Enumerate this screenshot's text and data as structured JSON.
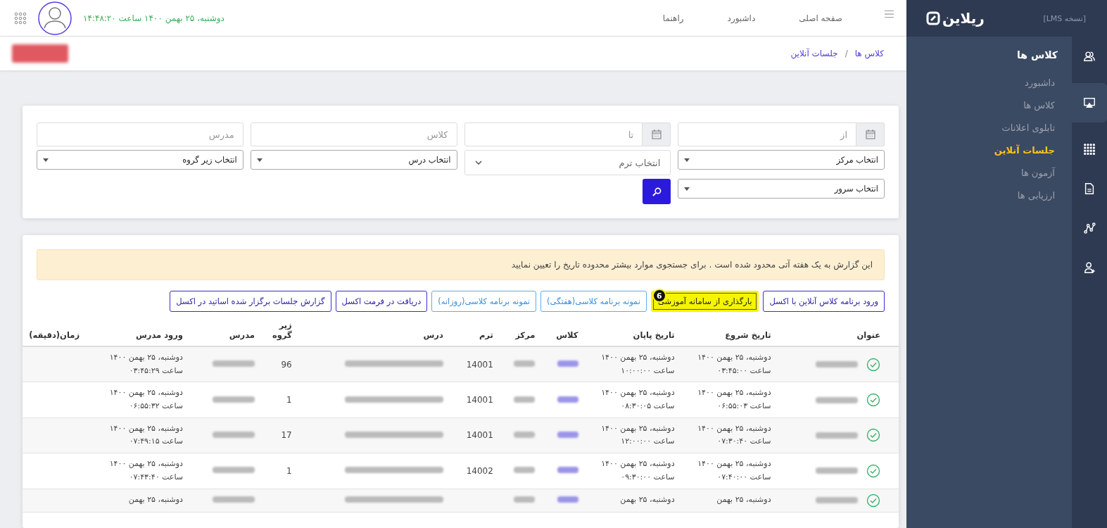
{
  "sidebar": {
    "logo": "ریلاین",
    "version": "[نسخه LMS]",
    "section_title": "کلاس ها",
    "rail": [
      {
        "kind": "users",
        "selected": false
      },
      {
        "kind": "screen",
        "selected": true
      },
      {
        "kind": "grid",
        "selected": false
      },
      {
        "kind": "document",
        "selected": false
      },
      {
        "kind": "graph",
        "selected": false
      },
      {
        "kind": "add-user",
        "selected": false
      }
    ],
    "items": [
      {
        "label": "داشبورد",
        "selected": false
      },
      {
        "label": "کلاس ها",
        "selected": false
      },
      {
        "label": "تابلوی اعلانات",
        "selected": false
      },
      {
        "label": "جلسات آنلاین",
        "selected": true
      },
      {
        "label": "آزمون ها",
        "selected": false
      },
      {
        "label": "ارزیابی ها",
        "selected": false
      }
    ]
  },
  "topbar": {
    "nav": [
      "صفحه اصلی",
      "داشبورد",
      "راهنما"
    ],
    "datetime": "دوشنبه، ۲۵ بهمن ۱۴۰۰ ساعت ۱۴:۴۸:۲۰"
  },
  "breadcrumb": [
    "کلاس ها",
    "جلسات آنلاین"
  ],
  "breadcrumb_separator": "/",
  "filters": {
    "from": {
      "placeholder": "از"
    },
    "to": {
      "placeholder": "تا"
    },
    "class": {
      "placeholder": "کلاس"
    },
    "teacher": {
      "placeholder": "مدرس"
    },
    "center": "انتخاب مرکز",
    "term": "انتخاب ترم",
    "lesson": "انتخاب درس",
    "subgroup": "انتخاب زیر گروه",
    "server": "انتخاب سرور"
  },
  "alert": "این گزارش به یک هفته آتی محدود شده است . برای جستجوی موارد بیشتر محدوده تاریخ را تعیین نمایید",
  "actions": [
    {
      "label": "ورود برنامه کلاس آنلاین با اکسل",
      "kind": "primary",
      "highlighted": false
    },
    {
      "label": "بارگذاری از سامانه آموزشی",
      "kind": "primary",
      "highlighted": true,
      "badge": "6"
    },
    {
      "label": "نمونه برنامه کلاسی(هفتگی)",
      "kind": "info",
      "highlighted": false
    },
    {
      "label": "نمونه برنامه کلاسی(روزانه)",
      "kind": "info",
      "highlighted": false
    },
    {
      "label": "دریافت در فرمت اکسل",
      "kind": "primary",
      "highlighted": false
    },
    {
      "label": "گزارش جلسات برگزار شده اساتید در اکسل",
      "kind": "primary",
      "highlighted": false
    }
  ],
  "table": {
    "columns": [
      "عنوان",
      "تاریخ شروع",
      "تاریخ پایان",
      "کلاس",
      "مرکز",
      "ترم",
      "درس",
      "زیر گروه",
      "مدرس",
      "ورود مدرس",
      "زمان(دقیقه)"
    ],
    "rows": [
      {
        "start": "دوشنبه، ۲۵ بهمن ۱۴۰۰ ساعت ۰۳:۴۵:۰۰",
        "end": "دوشنبه، ۲۵ بهمن ۱۴۰۰ ساعت ۱۰:۰۰:۰۰",
        "term": "14001",
        "subgroup": "96",
        "entry": "دوشنبه، ۲۵ بهمن ۱۴۰۰ ساعت ۰۳:۴۵:۲۹"
      },
      {
        "start": "دوشنبه، ۲۵ بهمن ۱۴۰۰ ساعت ۰۶:۵۵:۰۳",
        "end": "دوشنبه، ۲۵ بهمن ۱۴۰۰ ساعت ۰۸:۳۰:۰۵",
        "term": "14001",
        "subgroup": "1",
        "entry": "دوشنبه، ۲۵ بهمن ۱۴۰۰ ساعت ۰۶:۵۵:۳۲"
      },
      {
        "start": "دوشنبه، ۲۵ بهمن ۱۴۰۰ ساعت ۰۷:۳۰:۴۰",
        "end": "دوشنبه، ۲۵ بهمن ۱۴۰۰ ساعت ۱۲:۰۰:۰۰",
        "term": "14001",
        "subgroup": "17",
        "entry": "دوشنبه، ۲۵ بهمن ۱۴۰۰ ساعت ۰۷:۴۹:۱۵"
      },
      {
        "start": "دوشنبه، ۲۵ بهمن ۱۴۰۰ ساعت ۰۷:۴۰:۰۰",
        "end": "دوشنبه، ۲۵ بهمن ۱۴۰۰ ساعت ۰۹:۳۰:۰۰",
        "term": "14002",
        "subgroup": "1",
        "entry": "دوشنبه، ۲۵ بهمن ۱۴۰۰ ساعت ۰۷:۴۳:۴۰"
      },
      {
        "start": "دوشنبه، ۲۵ بهمن",
        "end": "دوشنبه، ۲۵ بهمن",
        "entry": "دوشنبه، ۲۵ بهمن"
      }
    ]
  }
}
